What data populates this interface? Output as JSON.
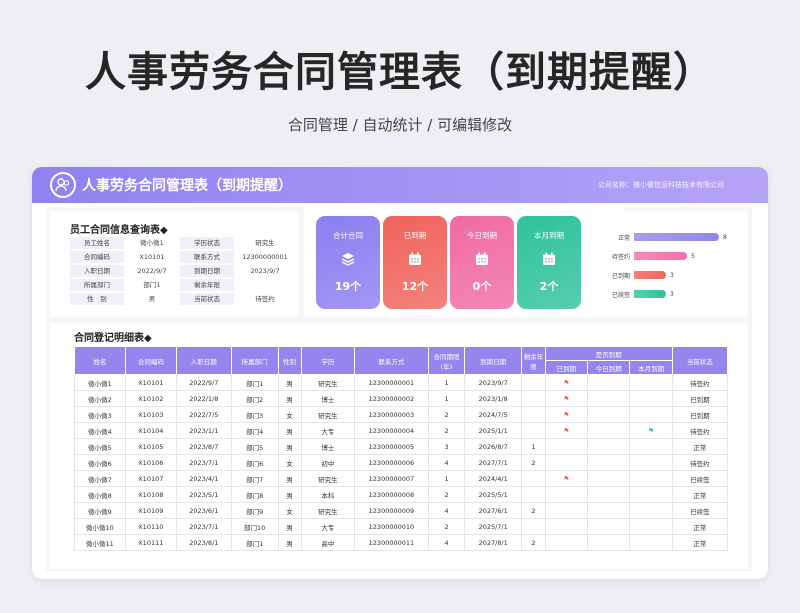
{
  "main_title": "人事劳务合同管理表（到期提醒）",
  "subtitle": "合同管理 / 自动统计 / 可编辑修改",
  "header": {
    "title": "人事劳务合同管理表（到期提醒）",
    "company": "公司名称：微小微信息科技技术有限公司"
  },
  "query": {
    "title": "员工合同信息查询表",
    "rows": [
      [
        "员工姓名",
        "微小微1",
        "学历状态",
        "研究生"
      ],
      [
        "合同编码",
        "X10101",
        "联系方式",
        "12300000001"
      ],
      [
        "入职日期",
        "2022/9/7",
        "到期日期",
        "2023/9/7"
      ],
      [
        "所属部门",
        "部门1",
        "剩余年限",
        ""
      ],
      [
        "性　别",
        "男",
        "当前状态",
        "待签约"
      ]
    ]
  },
  "kpis": [
    {
      "label": "合计合同",
      "value": "19个",
      "color": "#8b7ef0",
      "icon": "stack-icon"
    },
    {
      "label": "已到期",
      "value": "12个",
      "color": "#f0635c",
      "icon": "calendar-icon"
    },
    {
      "label": "今日到期",
      "value": "0个",
      "color": "#f06aa4",
      "icon": "calendar-icon"
    },
    {
      "label": "本月到期",
      "value": "2个",
      "color": "#2ec29a",
      "icon": "calendar-icon"
    }
  ],
  "status_bars": [
    {
      "label": "正常",
      "value": 8,
      "color": "#8f85ee"
    },
    {
      "label": "待签约",
      "value": 5,
      "color": "#f26fa8"
    },
    {
      "label": "已到期",
      "value": 3,
      "color": "#f0635c"
    },
    {
      "label": "已续签",
      "value": 3,
      "color": "#2ec29a"
    }
  ],
  "table": {
    "title": "合同登记明细表",
    "headers": [
      "姓名",
      "合同编码",
      "入职日期",
      "所属部门",
      "性别",
      "学历",
      "联系方式",
      "合同期限(年)",
      "到期日期",
      "剩余年限",
      "是否到期",
      "当前状态"
    ],
    "sub_headers": [
      "已到期",
      "今日到期",
      "本月到期"
    ],
    "rows": [
      [
        "微小微1",
        "X10101",
        "2022/9/7",
        "部门1",
        "男",
        "研究生",
        "12300000001",
        "1",
        "2023/9/7",
        "",
        "red",
        "",
        "",
        "待签约"
      ],
      [
        "微小微2",
        "X10102",
        "2022/1/8",
        "部门2",
        "男",
        "博士",
        "12300000002",
        "1",
        "2023/1/8",
        "",
        "red",
        "",
        "",
        "已到期"
      ],
      [
        "微小微3",
        "X10103",
        "2022/7/5",
        "部门3",
        "女",
        "研究生",
        "12300000003",
        "2",
        "2024/7/5",
        "",
        "red",
        "",
        "",
        "已到期"
      ],
      [
        "微小微4",
        "X10104",
        "2023/1/1",
        "部门4",
        "男",
        "大专",
        "12300000004",
        "2",
        "2025/1/1",
        "",
        "red",
        "",
        "green",
        "待签约"
      ],
      [
        "微小微5",
        "X10105",
        "2023/8/7",
        "部门5",
        "男",
        "博士",
        "12300000005",
        "3",
        "2026/8/7",
        "1",
        "",
        "",
        "",
        "正常"
      ],
      [
        "微小微6",
        "X10106",
        "2023/7/1",
        "部门6",
        "女",
        "初中",
        "12300000006",
        "4",
        "2027/7/1",
        "2",
        "",
        "",
        "",
        "待签约"
      ],
      [
        "微小微7",
        "X10107",
        "2023/4/1",
        "部门7",
        "男",
        "研究生",
        "12300000007",
        "1",
        "2024/4/1",
        "",
        "red",
        "",
        "",
        "已续签"
      ],
      [
        "微小微8",
        "X10108",
        "2023/5/1",
        "部门8",
        "男",
        "本科",
        "12300000008",
        "2",
        "2025/5/1",
        "",
        "",
        "",
        "",
        "正常"
      ],
      [
        "微小微9",
        "X10109",
        "2023/6/1",
        "部门9",
        "女",
        "研究生",
        "12300000009",
        "4",
        "2027/6/1",
        "2",
        "",
        "",
        "",
        "已续签"
      ],
      [
        "微小微10",
        "X10110",
        "2023/7/1",
        "部门10",
        "男",
        "大专",
        "12300000010",
        "2",
        "2025/7/1",
        "",
        "",
        "",
        "",
        "正常"
      ],
      [
        "微小微11",
        "X10111",
        "2023/8/1",
        "部门1",
        "男",
        "高中",
        "12300000011",
        "4",
        "2027/8/1",
        "2",
        "",
        "",
        "",
        "正常"
      ]
    ]
  }
}
